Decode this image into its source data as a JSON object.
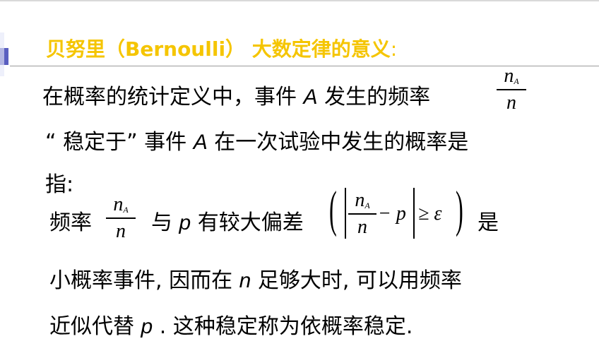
{
  "slide": {
    "title": "贝努里（Bernoulli） 大数定律的意义",
    "title_colon": ":",
    "title_color": "#f5c500",
    "line1_text": "在概率的统计定义中，事件 ",
    "line1_var": "A",
    "line1_text_b": " 发生的频率",
    "frac1": {
      "num": "n",
      "num_sub": "A",
      "den": "n"
    },
    "line2_text": "“ 稳定于” 事件 ",
    "line2_var": "A",
    "line2_text_b": " 在一次试验中发生的概率是",
    "line3_text": "指:",
    "line4_text": "频率",
    "frac2": {
      "num": "n",
      "num_sub": "A",
      "den": "n"
    },
    "line4_text_b": "与 ",
    "line4_var": "p",
    "line4_text_c": " 有较大偏差",
    "formula": {
      "num": "n",
      "num_sub": "A",
      "den": "n",
      "minus_p": "− p",
      "ge_eps": "≥ ε"
    },
    "line4_text_d": "是",
    "line5_text": "小概率事件, 因而在 ",
    "line5_var": "n",
    "line5_text_b": " 足够大时, 可以用频率",
    "line6_text": "近似代替 ",
    "line6_var": "p",
    "line6_text_b": " .  这种稳定称为依概率稳定."
  }
}
